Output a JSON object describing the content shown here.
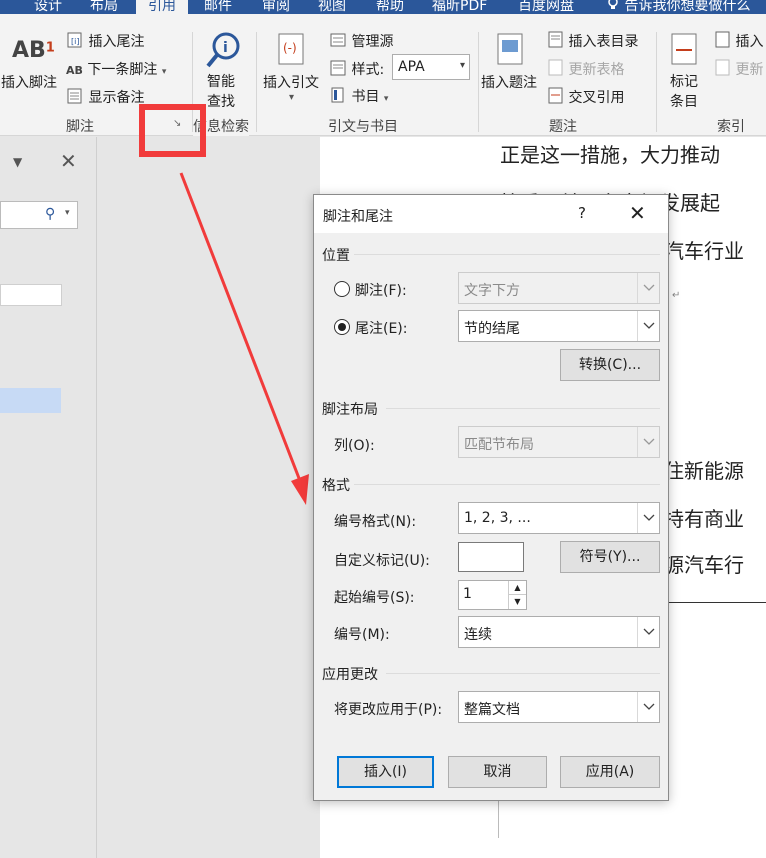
{
  "ribbon": {
    "tabs": [
      "设计",
      "布局",
      "引用",
      "邮件",
      "审阅",
      "视图",
      "帮助",
      "福昕PDF",
      "百度网盘",
      "告诉我你想要做什么"
    ],
    "footnotes": {
      "insert_footnote": "插入脚注",
      "insert_endnote": "插入尾注",
      "next_footnote": "下一条脚注",
      "show_notes": "显示备注",
      "group_label": "脚注"
    },
    "research": {
      "smart_lookup_1": "智能",
      "smart_lookup_2": "查找",
      "group_label": "信息检索"
    },
    "citations": {
      "insert_citation": "插入引文",
      "manage_sources": "管理源",
      "style_label": "样式:",
      "style_value": "APA",
      "bibliography": "书目",
      "group_label": "引文与书目"
    },
    "captions": {
      "insert_caption": "插入题注",
      "insert_table_of_figures": "插入表目录",
      "update_table": "更新表格",
      "cross_reference": "交叉引用",
      "group_label": "题注"
    },
    "index": {
      "mark_entry_1": "标记",
      "mark_entry_2": "条目",
      "insert_index": "插入",
      "update_index": "更新",
      "group_label": "索引"
    }
  },
  "document": {
    "lines": [
      "正是这一措施，大力推动",
      "拉重子羊只有市场发展起",
      "汽车行业",
      "住新能源",
      "持有商业",
      "源汽车行"
    ]
  },
  "dialog": {
    "title": "脚注和尾注",
    "help": "?",
    "location_section": "位置",
    "footnote_label": "脚注(F):",
    "footnote_value": "文字下方",
    "endnote_label": "尾注(E):",
    "endnote_value": "节的结尾",
    "convert_button": "转换(C)...",
    "layout_section": "脚注布局",
    "columns_label": "列(O):",
    "columns_value": "匹配节布局",
    "format_section": "格式",
    "number_format_label": "编号格式(N):",
    "number_format_value": "1, 2, 3, ...",
    "custom_mark_label": "自定义标记(U):",
    "custom_mark_value": "",
    "symbol_button": "符号(Y)...",
    "start_at_label": "起始编号(S):",
    "start_at_value": "1",
    "numbering_label": "编号(M):",
    "numbering_value": "连续",
    "apply_section": "应用更改",
    "apply_to_label": "将更改应用于(P):",
    "apply_to_value": "整篇文档",
    "insert_button": "插入(I)",
    "cancel_button": "取消",
    "apply_button": "应用(A)"
  },
  "colors": {
    "tab_bar": "#2b579a",
    "annotation_red": "#f13b3b",
    "default_button_border": "#0078d7"
  }
}
